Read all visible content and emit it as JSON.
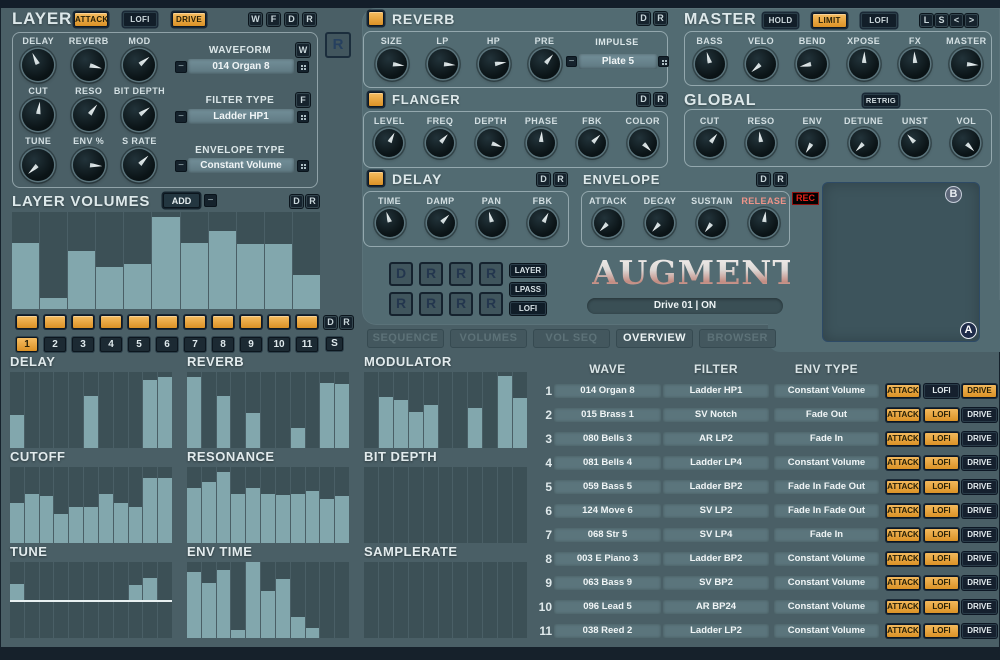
{
  "ui": {
    "minus": "−"
  },
  "colors": {
    "accent_orange": "#E8A33D",
    "rec_red": "#D01818",
    "release_label": "#EF938A",
    "bar_fill": "#82A7AD"
  },
  "layer": {
    "title": "LAYER",
    "toggles": [
      {
        "label": "ATTACK",
        "on": true
      },
      {
        "label": "LOFI",
        "on": false
      },
      {
        "label": "DRIVE",
        "on": true
      }
    ],
    "mini_buttons": [
      "W",
      "F",
      "D",
      "R"
    ],
    "r_button": "R",
    "knobs": [
      {
        "label": "DELAY",
        "angle": -25
      },
      {
        "label": "REVERB",
        "angle": 105
      },
      {
        "label": "MOD",
        "angle": 52
      },
      {
        "label": "CUT",
        "angle": 8
      },
      {
        "label": "RESO",
        "angle": 38
      },
      {
        "label": "BIT DEPTH",
        "angle": 55
      },
      {
        "label": "TUNE",
        "angle": 228
      },
      {
        "label": "ENV %",
        "angle": 95
      },
      {
        "label": "S RATE",
        "angle": 45
      }
    ],
    "selectors": [
      {
        "label": "WAVEFORM",
        "button": "W",
        "value": "014 Organ 8"
      },
      {
        "label": "FILTER TYPE",
        "button": "F",
        "value": "Ladder HP1"
      },
      {
        "label": "ENVELOPE TYPE",
        "button": "",
        "value": "Constant Volume"
      }
    ]
  },
  "layer_volumes": {
    "title": "LAYER VOLUMES",
    "add_label": "ADD",
    "dr_buttons": [
      "D",
      "R"
    ],
    "toggle_row_buttons": [
      "D",
      "R"
    ],
    "toggles": [
      true,
      true,
      true,
      true,
      true,
      true,
      true,
      true,
      true,
      true,
      true
    ],
    "slots": [
      "1",
      "2",
      "3",
      "4",
      "5",
      "6",
      "7",
      "8",
      "9",
      "10",
      "11"
    ],
    "active_slot": "1",
    "solo_label": "S"
  },
  "fx": {
    "reverb": {
      "title": "REVERB",
      "on": true,
      "dr": [
        "D",
        "R"
      ],
      "knobs": [
        {
          "label": "SIZE",
          "angle": 98
        },
        {
          "label": "LP",
          "angle": 95
        },
        {
          "label": "HP",
          "angle": 82
        },
        {
          "label": "PRE",
          "angle": 40
        }
      ],
      "impulse": {
        "label": "IMPULSE",
        "value": "Plate 5"
      }
    },
    "flanger": {
      "title": "FLANGER",
      "on": true,
      "dr": [
        "D",
        "R"
      ],
      "knobs": [
        {
          "label": "LEVEL",
          "angle": 28
        },
        {
          "label": "FREQ",
          "angle": 42
        },
        {
          "label": "DEPTH",
          "angle": 110
        },
        {
          "label": "PHASE",
          "angle": 4
        },
        {
          "label": "FBK",
          "angle": 45
        },
        {
          "label": "COLOR",
          "angle": 135
        }
      ]
    },
    "delay": {
      "title": "DELAY",
      "on": true,
      "dr": [
        "D",
        "R"
      ],
      "knobs": [
        {
          "label": "TIME",
          "angle": -18
        },
        {
          "label": "DAMP",
          "angle": 45
        },
        {
          "label": "PAN",
          "angle": -15
        },
        {
          "label": "FBK",
          "angle": 28
        }
      ]
    },
    "envelope": {
      "title": "ENVELOPE",
      "dr": [
        "D",
        "R"
      ],
      "rec_label": "REC",
      "knobs": [
        {
          "label": "ATTACK",
          "angle": 225
        },
        {
          "label": "DECAY",
          "angle": 222
        },
        {
          "label": "SUSTAIN",
          "angle": 218
        },
        {
          "label": "RELEASE",
          "angle": 8,
          "accent": true
        }
      ]
    },
    "master": {
      "title": "MASTER",
      "toggles": [
        {
          "label": "HOLD",
          "on": false
        },
        {
          "label": "LIMIT",
          "on": true
        },
        {
          "label": "LOFI",
          "on": false
        }
      ],
      "mini_buttons": [
        "L",
        "S",
        "<",
        ">"
      ],
      "knobs": [
        {
          "label": "BASS",
          "angle": -15
        },
        {
          "label": "VELO",
          "angle": 230
        },
        {
          "label": "BEND",
          "angle": 258
        },
        {
          "label": "XPOSE",
          "angle": 2
        },
        {
          "label": "FX",
          "angle": -3
        },
        {
          "label": "MASTER",
          "angle": 95
        }
      ]
    },
    "global": {
      "title": "GLOBAL",
      "retrig_label": "RETRIG",
      "knobs": [
        {
          "label": "CUT",
          "angle": 38
        },
        {
          "label": "RESO",
          "angle": -8
        },
        {
          "label": "ENV",
          "angle": 212
        },
        {
          "label": "DETUNE",
          "angle": 225
        },
        {
          "label": "UNST",
          "angle": -42
        },
        {
          "label": "VOL",
          "angle": 135
        }
      ]
    },
    "xy_pad": {
      "a_label": "A",
      "b_label": "B"
    },
    "dr_grid": {
      "rows": [
        [
          "D",
          "R",
          "R",
          "R"
        ],
        [
          "R",
          "R",
          "R",
          "R"
        ]
      ],
      "labels": [
        "LAYER",
        "LPASS",
        "LOFI"
      ]
    },
    "logo": "AUGMENT",
    "display_value": "Drive 01 | ON",
    "tabs": [
      {
        "label": "SEQUENCE",
        "active": false
      },
      {
        "label": "VOLUMES",
        "active": false
      },
      {
        "label": "VOL SEQ",
        "active": false
      },
      {
        "label": "OVERVIEW",
        "active": true
      },
      {
        "label": "BROWSER",
        "active": false
      }
    ]
  },
  "charts": {
    "layer_volumes": {
      "title": "LAYER VOLUMES",
      "type": "bar",
      "values": [
        0.68,
        0.11,
        0.6,
        0.43,
        0.46,
        0.95,
        0.68,
        0.8,
        0.67,
        0.67,
        0.35
      ]
    },
    "grid": [
      {
        "title": "DELAY",
        "type": "bar",
        "values": [
          0.43,
          0,
          0,
          0,
          0,
          0.69,
          0,
          0,
          0,
          0.89,
          0.93
        ]
      },
      {
        "title": "REVERB",
        "type": "bar",
        "values": [
          0.93,
          0,
          0.68,
          0,
          0.46,
          0,
          0,
          0.26,
          0,
          0.86,
          0.84
        ]
      },
      {
        "title": "CUTOFF",
        "type": "bar",
        "values": [
          0.53,
          0.65,
          0.62,
          0.38,
          0.48,
          0.48,
          0.64,
          0.53,
          0.47,
          0.86,
          0.86
        ]
      },
      {
        "title": "RESONANCE",
        "type": "bar",
        "values": [
          0.72,
          0.8,
          0.93,
          0.64,
          0.72,
          0.64,
          0.63,
          0.64,
          0.68,
          0.58,
          0.62
        ]
      },
      {
        "title": "TUNE",
        "type": "bar",
        "bipolar": true,
        "values": [
          0.43,
          0,
          0,
          0,
          0,
          0,
          0,
          0,
          0.39,
          0.57,
          0
        ]
      },
      {
        "title": "ENV TIME",
        "type": "bar",
        "values": [
          0.87,
          0.72,
          0.9,
          0.1,
          1.0,
          0.62,
          0.78,
          0.28,
          0.13,
          0,
          0
        ]
      },
      {
        "title": "MODULATOR",
        "type": "bar",
        "values": [
          0,
          0.67,
          0.63,
          0.48,
          0.56,
          0,
          0,
          0.52,
          0,
          0.95,
          0.66
        ]
      },
      {
        "title": "BIT DEPTH",
        "type": "bar",
        "values": [
          0,
          0,
          0,
          0,
          0,
          0,
          0,
          0,
          0,
          0,
          0
        ]
      },
      {
        "title": "SAMPLERATE",
        "type": "bar",
        "values": [
          0,
          0,
          0,
          0,
          0,
          0,
          0,
          0,
          0,
          0,
          0
        ]
      }
    ]
  },
  "overview_table": {
    "headers": [
      "WAVE",
      "FILTER",
      "ENV TYPE"
    ],
    "button_labels": [
      "ATTACK",
      "LOFI",
      "DRIVE"
    ],
    "rows": [
      {
        "num": "1",
        "wave": "014 Organ 8",
        "filter": "Ladder HP1",
        "env": "Constant Volume",
        "attack": true,
        "lofi": false,
        "drive": true
      },
      {
        "num": "2",
        "wave": "015 Brass 1",
        "filter": "SV Notch",
        "env": "Fade Out",
        "attack": true,
        "lofi": true,
        "drive": false
      },
      {
        "num": "3",
        "wave": "080 Bells 3",
        "filter": "AR LP2",
        "env": "Fade In",
        "attack": true,
        "lofi": true,
        "drive": false
      },
      {
        "num": "4",
        "wave": "081 Bells 4",
        "filter": "Ladder LP4",
        "env": "Constant Volume",
        "attack": true,
        "lofi": true,
        "drive": false
      },
      {
        "num": "5",
        "wave": "059 Bass 5",
        "filter": "Ladder BP2",
        "env": "Fade In Fade Out",
        "attack": true,
        "lofi": true,
        "drive": false
      },
      {
        "num": "6",
        "wave": "124 Move 6",
        "filter": "SV LP2",
        "env": "Fade In Fade Out",
        "attack": true,
        "lofi": true,
        "drive": false
      },
      {
        "num": "7",
        "wave": "068 Str 5",
        "filter": "SV LP4",
        "env": "Fade In",
        "attack": true,
        "lofi": true,
        "drive": false
      },
      {
        "num": "8",
        "wave": "003 E Piano 3",
        "filter": "Ladder BP2",
        "env": "Constant Volume",
        "attack": true,
        "lofi": true,
        "drive": false
      },
      {
        "num": "9",
        "wave": "063 Bass 9",
        "filter": "SV BP2",
        "env": "Constant Volume",
        "attack": true,
        "lofi": true,
        "drive": false
      },
      {
        "num": "10",
        "wave": "096 Lead 5",
        "filter": "AR BP24",
        "env": "Constant Volume",
        "attack": true,
        "lofi": true,
        "drive": false
      },
      {
        "num": "11",
        "wave": "038 Reed 2",
        "filter": "Ladder LP2",
        "env": "Constant Volume",
        "attack": true,
        "lofi": true,
        "drive": false
      }
    ]
  }
}
